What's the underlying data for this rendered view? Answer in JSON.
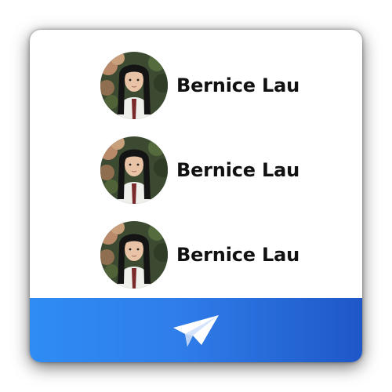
{
  "users": [
    {
      "name": "Bernice Lau"
    },
    {
      "name": "Bernice Lau"
    },
    {
      "name": "Bernice Lau"
    }
  ],
  "footer": {
    "action_icon": "paper-plane-icon"
  },
  "colors": {
    "footer_gradient_start": "#2f8cf5",
    "footer_gradient_end": "#1f57c8",
    "name_text": "#111111",
    "icon": "#ffffff"
  }
}
